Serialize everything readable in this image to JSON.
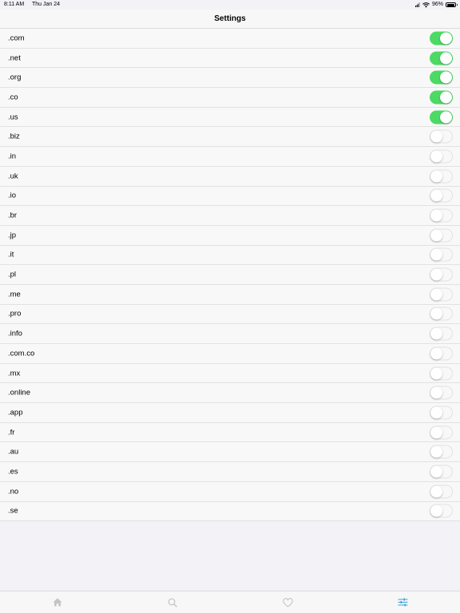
{
  "status_bar": {
    "time": "8:11 AM",
    "date": "Thu Jan 24",
    "battery": "96%"
  },
  "nav": {
    "title": "Settings"
  },
  "tlds": [
    {
      "label": ".com",
      "enabled": true
    },
    {
      "label": ".net",
      "enabled": true
    },
    {
      "label": ".org",
      "enabled": true
    },
    {
      "label": ".co",
      "enabled": true
    },
    {
      "label": ".us",
      "enabled": true
    },
    {
      "label": ".biz",
      "enabled": false
    },
    {
      "label": ".in",
      "enabled": false
    },
    {
      "label": ".uk",
      "enabled": false
    },
    {
      "label": ".io",
      "enabled": false
    },
    {
      "label": ".br",
      "enabled": false
    },
    {
      "label": ".jp",
      "enabled": false
    },
    {
      "label": ".it",
      "enabled": false
    },
    {
      "label": ".pl",
      "enabled": false
    },
    {
      "label": ".me",
      "enabled": false
    },
    {
      "label": ".pro",
      "enabled": false
    },
    {
      "label": ".info",
      "enabled": false
    },
    {
      "label": ".com.co",
      "enabled": false
    },
    {
      "label": ".mx",
      "enabled": false
    },
    {
      "label": ".online",
      "enabled": false
    },
    {
      "label": ".app",
      "enabled": false
    },
    {
      "label": ".fr",
      "enabled": false
    },
    {
      "label": ".au",
      "enabled": false
    },
    {
      "label": ".es",
      "enabled": false
    },
    {
      "label": ".no",
      "enabled": false
    },
    {
      "label": ".se",
      "enabled": false
    }
  ],
  "tab_bar": {
    "tabs": [
      {
        "icon": "home-icon",
        "active": false
      },
      {
        "icon": "search-icon",
        "active": false
      },
      {
        "icon": "heart-icon",
        "active": false
      },
      {
        "icon": "sliders-icon",
        "active": true
      }
    ]
  },
  "colors": {
    "toggle_on": "#4cd964",
    "tab_active": "#3aa0d8",
    "tab_inactive": "#c4c4c8"
  }
}
